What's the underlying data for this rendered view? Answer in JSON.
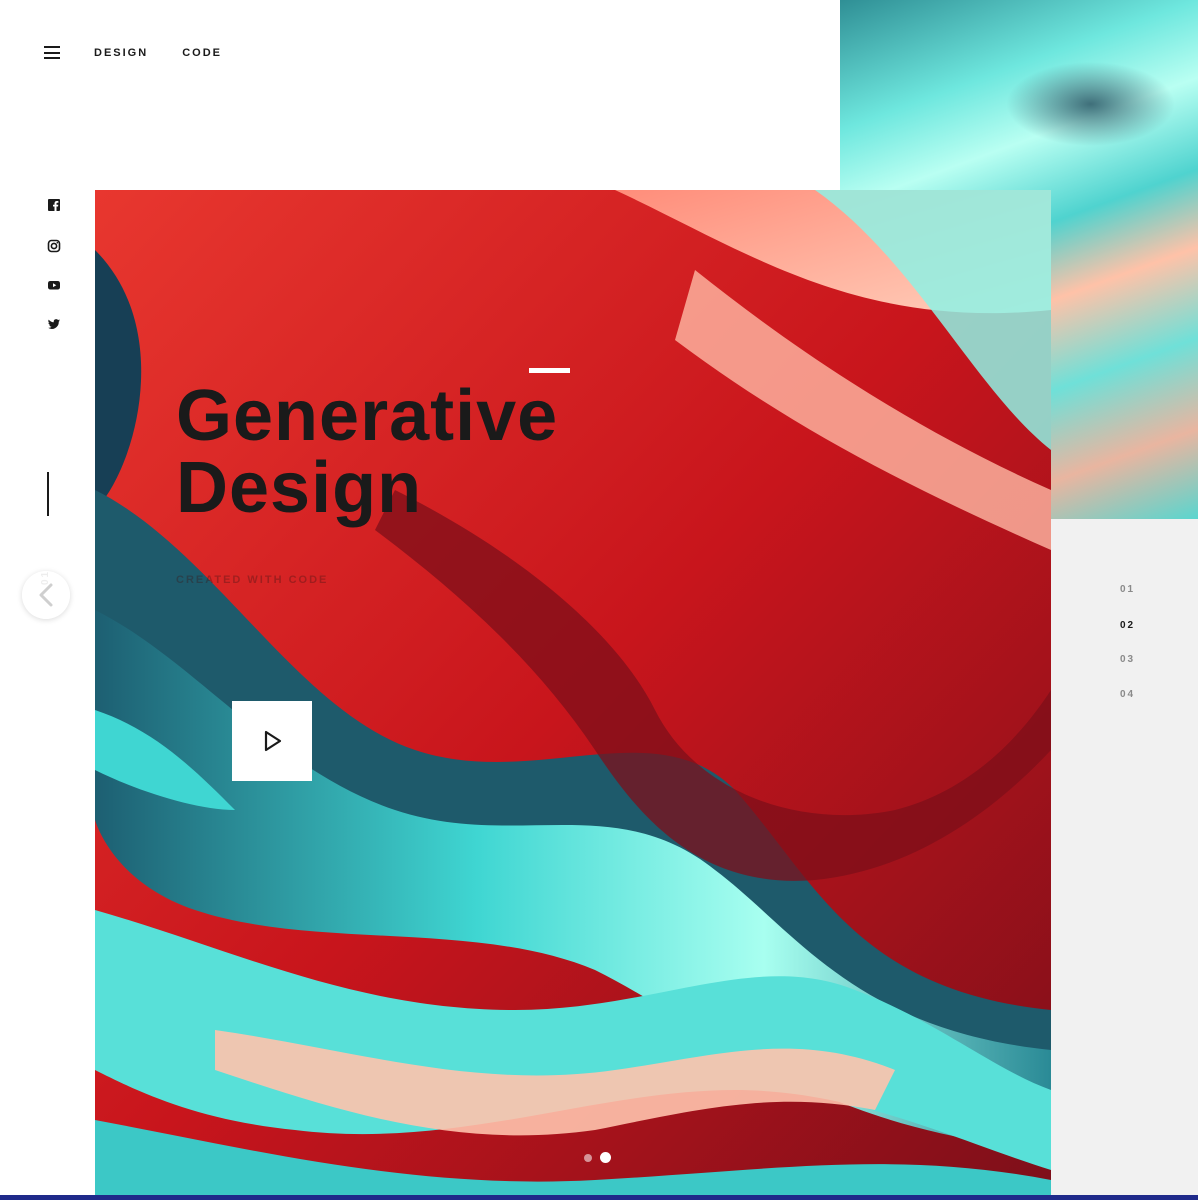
{
  "nav": {
    "design": "DESIGN",
    "code": "CODE"
  },
  "hero": {
    "title_line1": "Generative",
    "title_line2": "Design",
    "subtitle": "CREATED WITH CODE"
  },
  "side_label": "01",
  "pager": [
    "01",
    "02",
    "03",
    "04"
  ],
  "pager_active": "02",
  "colors": {
    "accent_dark": "#1a1a1a",
    "panel_grey": "#f1f1f1",
    "red": "#b5121b",
    "teal": "#4fd3cf"
  },
  "icons": [
    "menu-icon",
    "facebook-icon",
    "instagram-icon",
    "youtube-icon",
    "twitter-icon",
    "chevron-left-icon",
    "play-icon"
  ]
}
